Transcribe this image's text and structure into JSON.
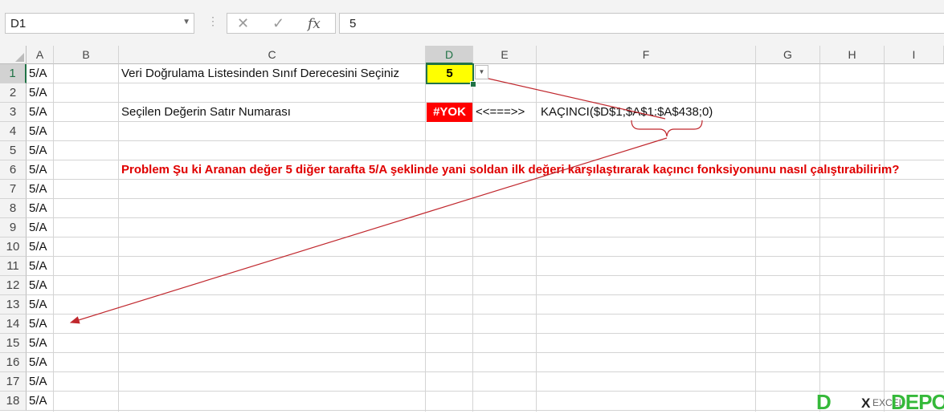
{
  "formula_bar": {
    "name_box": "D1",
    "cancel_icon": "✕",
    "enter_icon": "✓",
    "fx_label": "fx",
    "formula": "5"
  },
  "columns": [
    "A",
    "B",
    "C",
    "D",
    "E",
    "F",
    "G",
    "H",
    "I"
  ],
  "selected_column": "D",
  "rows": [
    "1",
    "2",
    "3",
    "4",
    "5",
    "6",
    "7",
    "8",
    "9",
    "10",
    "11",
    "12",
    "13",
    "14",
    "15",
    "16",
    "17",
    "18"
  ],
  "selected_row": "1",
  "cells": {
    "column_a_value": "5/A",
    "c1": "Veri Doğrulama Listesinden Sınıf Derecesini Seçiniz",
    "d1": "5",
    "c3": "Seçilen Değerin Satır Numarası",
    "d3": "#YOK",
    "e3": "<<===>>",
    "f3": "KAÇINCI($D$1;$A$1:$A$438;0)",
    "c6": "Problem Şu ki Aranan değer 5 diğer tarafta 5/A şeklinde yani soldan ilk değeri karşılaştırarak kaçıncı fonksiyonunu nasıl çalıştırabilirim?"
  },
  "logo": {
    "mark": "D",
    "x": "X",
    "ex": "EXCEL",
    "depo": "DEPO"
  },
  "colors": {
    "accent": "#217346",
    "highlight": "#ffff00",
    "error": "#ff0000",
    "annotation": "#c0272d",
    "logo": "#35b93a"
  },
  "icons": [
    "dropdown-chevron-icon",
    "cancel-icon",
    "enter-icon",
    "fx-icon",
    "select-all-icon",
    "validation-dropdown-icon"
  ]
}
